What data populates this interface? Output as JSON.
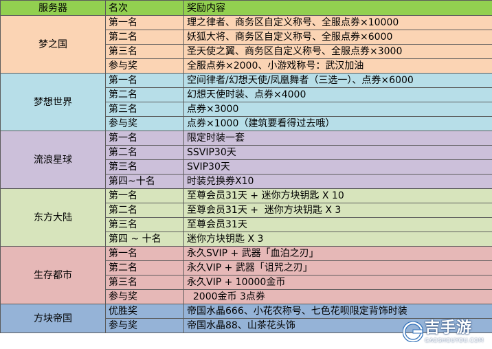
{
  "header": {
    "server": "服务器",
    "rank": "名次",
    "reward": "奖励内容"
  },
  "groups": [
    {
      "server": "梦之国",
      "rows": [
        {
          "rank": "第一名",
          "reward": "理之律者、商务区自定义称号、全服点券×10000"
        },
        {
          "rank": "第二名",
          "reward": "妖狐大将、商务区自定义称号、全服点券×6000"
        },
        {
          "rank": "第三名",
          "reward": "圣天使之翼、商务区自定义称号、全服点券×3000"
        },
        {
          "rank": "参与奖",
          "reward": "全服点券×2000、小游戏称号：武汉加油"
        }
      ]
    },
    {
      "server": "梦想世界",
      "rows": [
        {
          "rank": "第一名",
          "reward": "空间律者/幻想天使/凤凰舞者（三选一）、点券×6000"
        },
        {
          "rank": "第二名",
          "reward": "幻想天使时装、点券×4000"
        },
        {
          "rank": "第三名",
          "reward": "点券×3000"
        },
        {
          "rank": "参与奖",
          "reward": "点券×1000（建筑要看得过去哦）"
        }
      ]
    },
    {
      "server": "流浪星球",
      "rows": [
        {
          "rank": "第一名",
          "reward": "限定时装一套"
        },
        {
          "rank": "第二名",
          "reward": "SSVIP30天"
        },
        {
          "rank": "第三名",
          "reward": "SVIP30天"
        },
        {
          "rank": "第四~十名",
          "reward": "时装兑换券X10"
        }
      ]
    },
    {
      "server": "东方大陆",
      "rows": [
        {
          "rank": "第一名",
          "reward": "至尊会员31天 + 迷你方块钥匙 X 10"
        },
        {
          "rank": "第二名",
          "reward": "至尊会员31天 +  迷你方块钥匙 X 3"
        },
        {
          "rank": "第三名",
          "reward": "至尊会员31天"
        },
        {
          "rank": "第四 ~ 十名",
          "reward": "迷你方块钥匙 X 3"
        }
      ]
    },
    {
      "server": "生存都市",
      "rows": [
        {
          "rank": "第一名",
          "reward": "永久SVIP + 武器「血泊之刃」"
        },
        {
          "rank": "第二名",
          "reward": "永久VIP + 武器「诅咒之刃」"
        },
        {
          "rank": "第三名",
          "reward": "永久VIP + 10000金币"
        },
        {
          "rank": "参与奖",
          "reward": "  2000金币 3点券"
        }
      ]
    },
    {
      "server": "方块帝国",
      "rows": [
        {
          "rank": "优胜奖",
          "reward": "帝国水晶666、小花农称号、七色花呗限定背饰时装"
        },
        {
          "rank": "参与奖",
          "reward": "帝国水晶88、山茶花头饰"
        }
      ]
    }
  ],
  "watermark": {
    "brand": "吉手游",
    "domain": "GAOSHOUYOU.COM",
    "colors": {
      "primary": "#2f6fb8",
      "accent": "#ffffff"
    }
  },
  "colors": {
    "header": "#92d050",
    "group_backgrounds": [
      "#fbd4b4",
      "#b7dee8",
      "#ccc0da",
      "#d7e4bc",
      "#e6b8b7",
      "#95b3d7"
    ]
  }
}
